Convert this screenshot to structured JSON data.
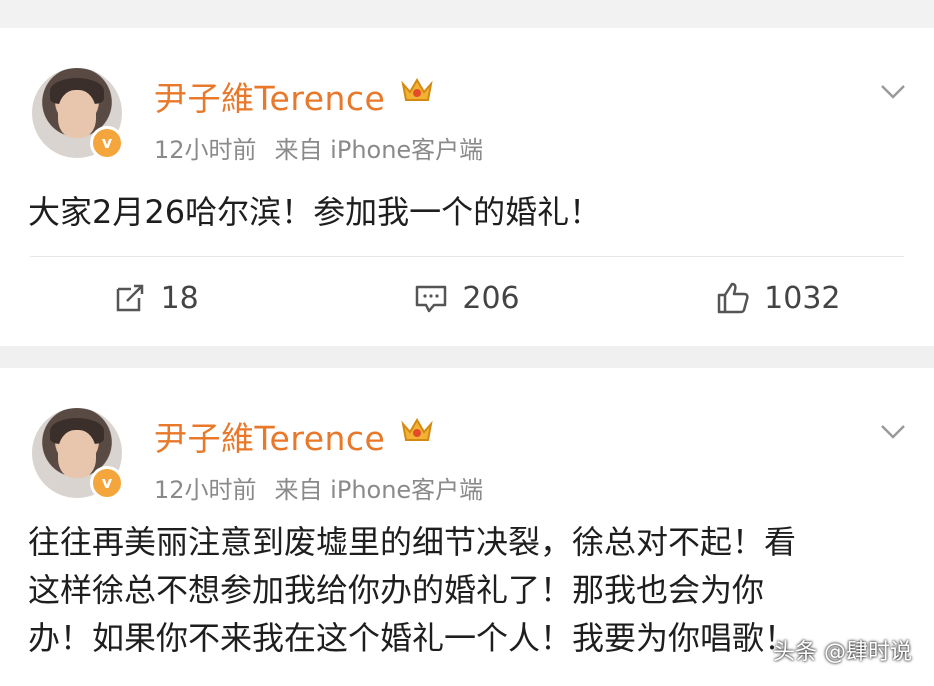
{
  "posts": [
    {
      "author": "尹子維Terence",
      "time": "12小时前",
      "source": "来自 iPhone客户端",
      "text": "大家2月26哈尔滨！参加我一个的婚礼！",
      "actions": {
        "repost": "18",
        "comment": "206",
        "like": "1032"
      }
    },
    {
      "author": "尹子維Terence",
      "time": "12小时前",
      "source": "来自 iPhone客户端",
      "text_lines": [
        "往往再美丽注意到废墟里的细节决裂，徐总对不起！看",
        "这样徐总不想参加我给你办的婚礼了！那我也会为你",
        "办！如果你不来我在这个婚礼一个人！我要为你唱歌！"
      ]
    }
  ],
  "watermark": "头条 @肆时说",
  "icons": {
    "verified": "verified-badge-icon",
    "crown": "vip-crown-icon",
    "chevron": "chevron-down-icon",
    "repost": "repost-icon",
    "comment": "comment-icon",
    "like": "thumbs-up-icon"
  },
  "colors": {
    "author": "#e8782a",
    "meta": "#8a8a8a",
    "badge": "#f4a53b"
  }
}
